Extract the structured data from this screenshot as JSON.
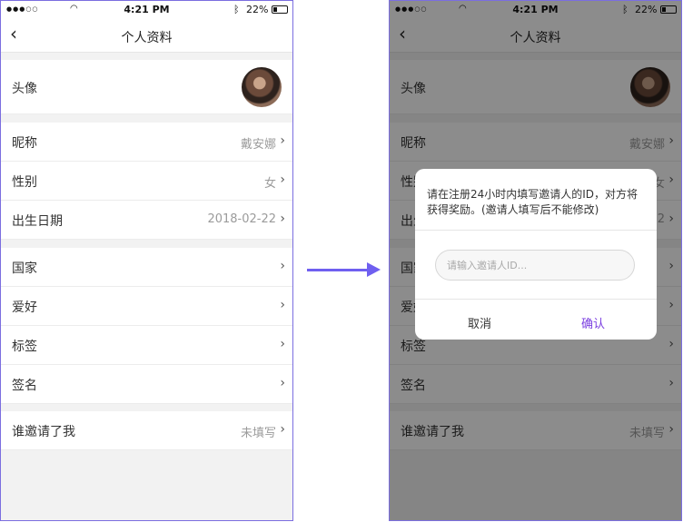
{
  "status": {
    "carrier": "●●●○○",
    "time": "4:21 PM",
    "battery": "22%"
  },
  "nav": {
    "back": "‹",
    "title": "个人资料"
  },
  "profile": {
    "avatar_label": "头像",
    "rows": [
      {
        "label": "昵称",
        "value": "戴安娜"
      },
      {
        "label": "性别",
        "value": "女"
      },
      {
        "label": "出生日期",
        "value": "2018-02-22"
      },
      {
        "label": "国家",
        "value": ""
      },
      {
        "label": "爱好",
        "value": ""
      },
      {
        "label": "标签",
        "value": ""
      },
      {
        "label": "签名",
        "value": ""
      },
      {
        "label": "谁邀请了我",
        "value": "未填写"
      }
    ],
    "chevron": "›"
  },
  "dialog": {
    "message": "请在注册24小时内填写邀请人的ID，对方将获得奖励。(邀请人填写后不能修改)",
    "input_placeholder": "请输入邀请人ID...",
    "cancel_label": "取消",
    "confirm_label": "确认"
  },
  "colors": {
    "accent": "#6f5ff0",
    "confirm": "#7b3fe0",
    "frame": "#7b6ee0"
  }
}
